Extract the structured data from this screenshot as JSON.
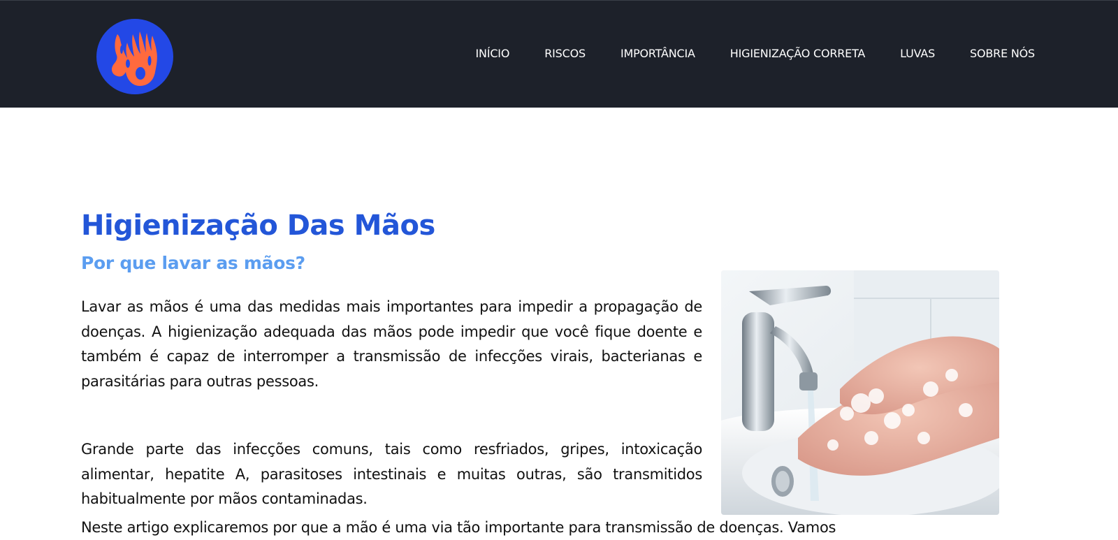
{
  "header": {
    "logo_icon": "hand-print-logo",
    "nav": [
      {
        "label": "INÍCIO"
      },
      {
        "label": "RISCOS"
      },
      {
        "label": "IMPORTÂNCIA"
      },
      {
        "label": "HIGIENIZAÇÃO CORRETA"
      },
      {
        "label": "LUVAS"
      },
      {
        "label": "SOBRE NÓS"
      }
    ]
  },
  "main": {
    "title": "Higienização Das Mãos",
    "subtitle": "Por que lavar as mãos?",
    "paragraphs": [
      "Lavar as mãos é uma das medidas mais importantes para impedir a propagação de doenças. A higienização adequada das mãos pode impedir que você fique doente e também é capaz de interromper a transmissão de infecções virais, bacterianas e parasitárias para outras pessoas.",
      "Grande parte das infecções comuns, tais como resfriados, gripes, intoxicação alimentar, hepatite A, parasitoses intestinais e muitas outras, são transmitidos habitualmente por mãos contaminadas.",
      "Neste artigo explicaremos por que a mão é uma via tão importante para transmissão de doenças. Vamos"
    ],
    "image_icon": "hand-washing-photo"
  },
  "colors": {
    "navbar_bg": "#1d212a",
    "title": "#2356d8",
    "subtitle": "#5b9df0",
    "logo_bg": "#2348e6",
    "logo_fg": "#ff6a3d"
  }
}
